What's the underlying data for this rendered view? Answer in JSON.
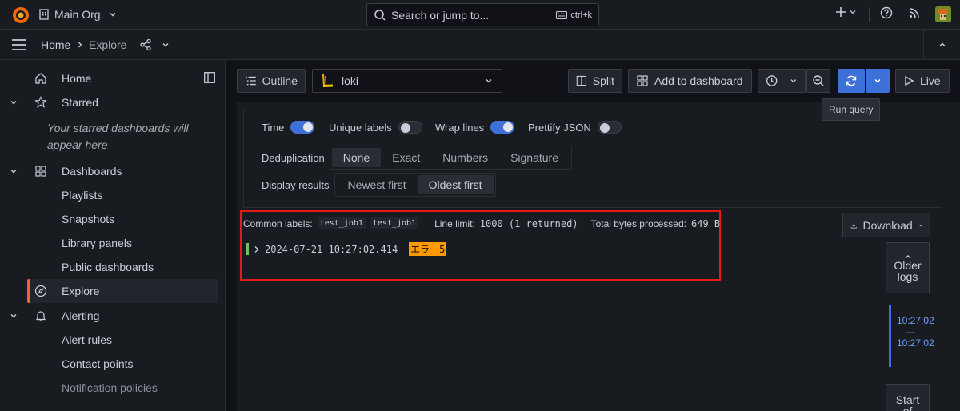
{
  "topbar": {
    "org_name": "Main Org.",
    "search_placeholder": "Search or jump to...",
    "search_shortcut": "ctrl+k"
  },
  "breadcrumb": {
    "home": "Home",
    "current": "Explore"
  },
  "sidebar": {
    "items": [
      {
        "label": "Home"
      },
      {
        "label": "Starred"
      },
      {
        "label": "Dashboards"
      },
      {
        "label": "Playlists"
      },
      {
        "label": "Snapshots"
      },
      {
        "label": "Library panels"
      },
      {
        "label": "Public dashboards"
      },
      {
        "label": "Explore"
      },
      {
        "label": "Alerting"
      },
      {
        "label": "Alert rules"
      },
      {
        "label": "Contact points"
      },
      {
        "label": "Notification policies"
      }
    ],
    "starred_empty": "Your starred dashboards will appear here"
  },
  "toolbar": {
    "outline": "Outline",
    "datasource": "loki",
    "split": "Split",
    "add_to_dashboard": "Add to dashboard",
    "live": "Live",
    "run_query_tooltip": "Run query"
  },
  "options": {
    "time": "Time",
    "unique_labels": "Unique labels",
    "wrap_lines": "Wrap lines",
    "prettify_json": "Prettify JSON",
    "deduplication_label": "Deduplication",
    "dedup_options": [
      "None",
      "Exact",
      "Numbers",
      "Signature"
    ],
    "display_label": "Display results",
    "display_options": [
      "Newest first",
      "Oldest first"
    ]
  },
  "logs": {
    "common_labels_label": "Common labels:",
    "common_labels": [
      "test_job1",
      "test_job1"
    ],
    "line_limit_label": "Line limit:",
    "line_limit_value": "1000 (1 returned)",
    "bytes_label": "Total bytes processed:",
    "bytes_value": "649 B",
    "download": "Download",
    "line": {
      "timestamp": "2024-07-21 10:27:02.414",
      "message": "エラー5"
    },
    "older_logs_1": "Older",
    "older_logs_2": "logs",
    "range_start": "10:27:02",
    "range_sep": "—",
    "range_end": "10:27:02",
    "start_1": "Start",
    "start_2": "of"
  },
  "colors": {
    "accent": "#3d71d9",
    "highlight": "#ff9900",
    "annotation": "#e51a1a",
    "log_level": "#73bf69"
  }
}
